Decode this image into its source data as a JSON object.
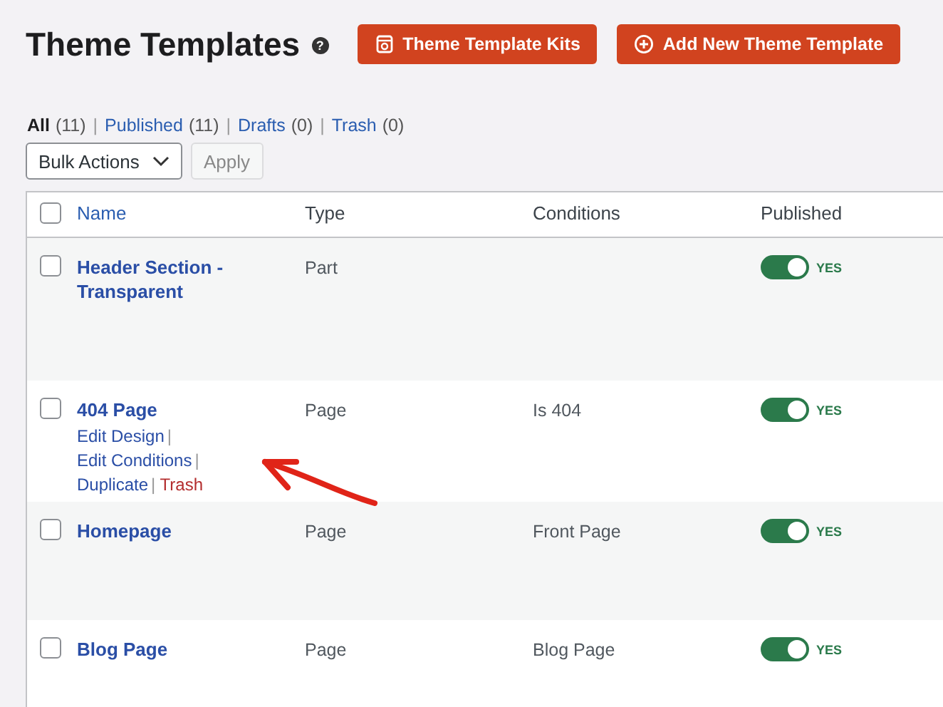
{
  "page": {
    "title": "Theme Templates",
    "help_icon": "?"
  },
  "header_buttons": [
    {
      "label": "Theme Template Kits",
      "kind": "kits"
    },
    {
      "label": "Add New Theme Template",
      "kind": "add"
    }
  ],
  "filters": [
    {
      "label": "All",
      "count": "(11)",
      "selected": true
    },
    {
      "label": "Published",
      "count": "(11)",
      "selected": false
    },
    {
      "label": "Drafts",
      "count": "(0)",
      "selected": false
    },
    {
      "label": "Trash",
      "count": "(0)",
      "selected": false
    }
  ],
  "filter_separator": "|",
  "bulk_actions": {
    "value": "Bulk Actions",
    "apply": "Apply",
    "apply_disabled": true
  },
  "table": {
    "select_all_checked": false,
    "columns": [
      "Name",
      "Type",
      "Conditions",
      "Published"
    ],
    "rows": [
      {
        "name": "Header Section - Transparent",
        "type": "Part",
        "published": true,
        "status": "YES",
        "checked": false,
        "actions": []
      },
      {
        "name": "404 Page",
        "type": "Page",
        "conditions": "Is 404",
        "published": true,
        "status": "YES",
        "checked": false,
        "actions": [
          {
            "label": "Edit Design",
            "kind": "link",
            "sep": "|"
          },
          {
            "label": "Edit Conditions",
            "kind": "link",
            "sep": "|"
          },
          {
            "label": "Duplicate",
            "kind": "link",
            "sep": "|"
          },
          {
            "label": "Trash",
            "kind": "trash"
          }
        ]
      },
      {
        "name": "Homepage",
        "type": "Page",
        "conditions": "Front Page",
        "published": true,
        "status": "YES",
        "checked": false,
        "actions": []
      },
      {
        "name": "Blog Page",
        "type": "Page",
        "conditions": "Blog Page",
        "published": true,
        "status": "YES",
        "checked": false,
        "actions": []
      }
    ]
  },
  "annotation": {
    "kind": "arrow"
  }
}
